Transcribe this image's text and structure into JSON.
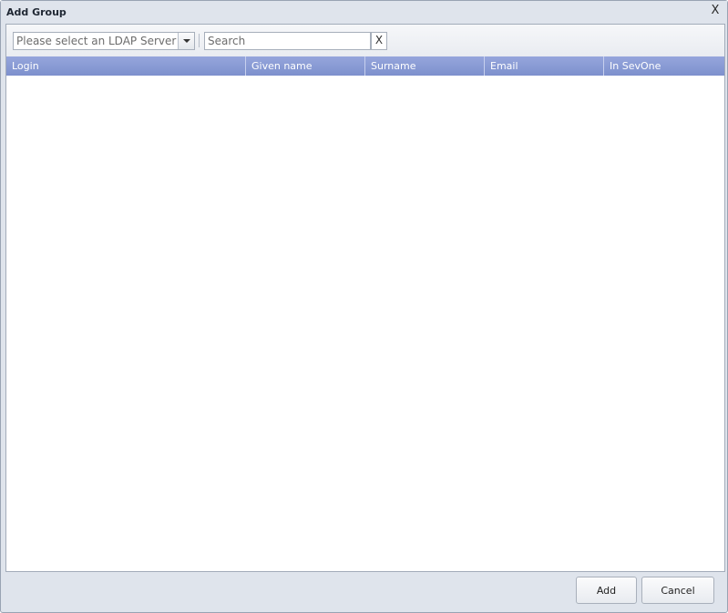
{
  "window": {
    "title": "Add Group",
    "close_label": "X"
  },
  "toolbar": {
    "server_select": {
      "placeholder": "Please select an LDAP Server"
    },
    "search": {
      "placeholder": "Search",
      "value": ""
    },
    "clear_label": "X"
  },
  "grid": {
    "columns": [
      "Login",
      "Given name",
      "Surname",
      "Email",
      "In SevOne"
    ],
    "rows": []
  },
  "footer": {
    "add_label": "Add",
    "cancel_label": "Cancel"
  },
  "colors": {
    "header_gradient_top": "#96a6dc",
    "header_gradient_bottom": "#7d90cd",
    "window_bg": "#dfe4ec"
  }
}
